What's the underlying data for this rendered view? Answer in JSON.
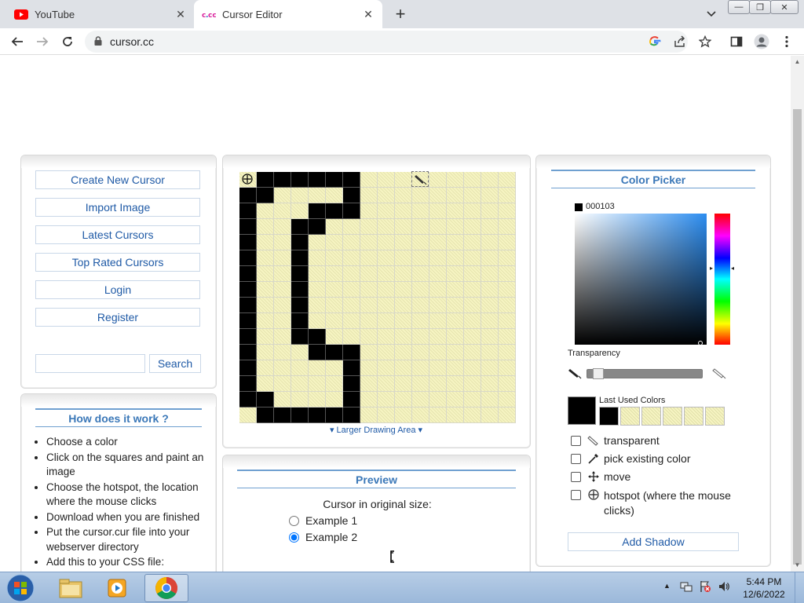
{
  "browser": {
    "tabs": [
      {
        "title": "YouTube",
        "icon": "youtube-icon"
      },
      {
        "title": "Cursor Editor",
        "icon": "cursor-cc-icon"
      }
    ],
    "url": "cursor.cc"
  },
  "menu": {
    "buttons": [
      "Create New Cursor",
      "Import Image",
      "Latest Cursors",
      "Top Rated Cursors",
      "Login",
      "Register"
    ],
    "search_label": "Search",
    "search_value": ""
  },
  "how": {
    "title": "How does it work ?",
    "steps": [
      "Choose a color",
      "Click on the squares and paint an image",
      "Choose the hotspot, the location where the mouse clicks",
      "Download when you are finished",
      "Put the cursor.cur file into your webserver directory",
      "Add this to your CSS file:"
    ]
  },
  "editor": {
    "grid_size": 16,
    "black_cells": [
      [
        0,
        1
      ],
      [
        0,
        2
      ],
      [
        0,
        3
      ],
      [
        0,
        4
      ],
      [
        0,
        5
      ],
      [
        0,
        6
      ],
      [
        1,
        0
      ],
      [
        1,
        1
      ],
      [
        1,
        6
      ],
      [
        2,
        0
      ],
      [
        2,
        4
      ],
      [
        2,
        5
      ],
      [
        2,
        6
      ],
      [
        3,
        0
      ],
      [
        3,
        3
      ],
      [
        3,
        4
      ],
      [
        4,
        0
      ],
      [
        4,
        3
      ],
      [
        5,
        0
      ],
      [
        5,
        3
      ],
      [
        6,
        0
      ],
      [
        6,
        3
      ],
      [
        7,
        0
      ],
      [
        7,
        3
      ],
      [
        8,
        0
      ],
      [
        8,
        3
      ],
      [
        9,
        0
      ],
      [
        9,
        3
      ],
      [
        10,
        0
      ],
      [
        10,
        3
      ],
      [
        10,
        4
      ],
      [
        11,
        0
      ],
      [
        11,
        4
      ],
      [
        11,
        5
      ],
      [
        11,
        6
      ],
      [
        12,
        0
      ],
      [
        12,
        6
      ],
      [
        13,
        0
      ],
      [
        13,
        6
      ],
      [
        14,
        0
      ],
      [
        14,
        1
      ],
      [
        14,
        6
      ],
      [
        15,
        1
      ],
      [
        15,
        2
      ],
      [
        15,
        3
      ],
      [
        15,
        4
      ],
      [
        15,
        5
      ],
      [
        15,
        6
      ]
    ],
    "larger_area_label": "Larger Drawing Area"
  },
  "preview": {
    "title": "Preview",
    "subtitle": "Cursor in original size:",
    "options": [
      {
        "label": "Example 1",
        "checked": false
      },
      {
        "label": "Example 2",
        "checked": true
      }
    ]
  },
  "color_picker": {
    "title": "Color Picker",
    "hex_value": "000103",
    "transparency_label": "Transparency",
    "transparency_level": 0.05,
    "last_used_label": "Last Used Colors",
    "current_color": "#000000",
    "last_colors": [
      "#000000",
      "transparent",
      "transparent",
      "transparent",
      "transparent",
      "transparent"
    ],
    "options": [
      {
        "label": "transparent",
        "icon": "transparent-pen-icon"
      },
      {
        "label": "pick existing color",
        "icon": "eyedropper-icon"
      },
      {
        "label": "move",
        "icon": "move-icon"
      },
      {
        "label": "hotspot (where the mouse clicks)",
        "icon": "hotspot-icon"
      }
    ],
    "shadow_label": "Add Shadow"
  },
  "taskbar": {
    "time": "5:44 PM",
    "date": "12/6/2022"
  }
}
